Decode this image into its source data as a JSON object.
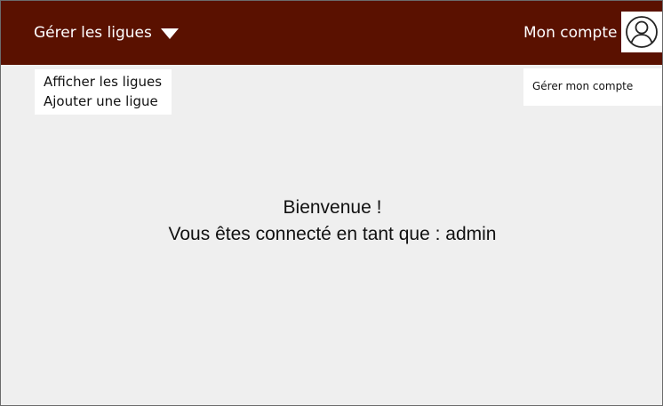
{
  "header": {
    "manage_leagues_label": "Gérer les ligues",
    "account_label": "Mon compte",
    "avatar_icon": "user-circle-icon",
    "caret_icon": "caret-down-icon",
    "background_color": "#5a1100"
  },
  "leagues_menu": {
    "items": [
      {
        "label": "Afficher les ligues"
      },
      {
        "label": "Ajouter une ligue"
      }
    ]
  },
  "account_menu": {
    "items": [
      {
        "label": "Gérer mon compte"
      }
    ]
  },
  "main": {
    "welcome_line": "Bienvenue !",
    "connected_line": "Vous êtes connecté en tant que : admin"
  }
}
